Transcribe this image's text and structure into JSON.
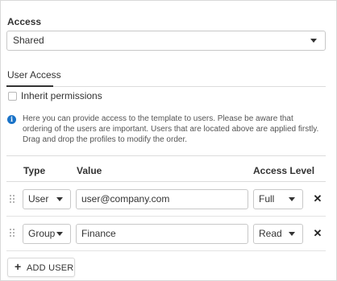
{
  "access": {
    "label": "Access",
    "selected": "Shared"
  },
  "tabs": [
    {
      "label": "User Access",
      "active": true
    }
  ],
  "inherit": {
    "label": "Inherit permissions",
    "checked": false
  },
  "info": {
    "text": "Here you can provide access to the template to users. Please be aware that ordering of the users are important. Users that are located above are applied firstly. Drag and drop the profiles to modify the order."
  },
  "table": {
    "headers": {
      "type": "Type",
      "value": "Value",
      "level": "Access Level"
    },
    "rows": [
      {
        "type": "User",
        "value": "user@company.com",
        "level": "Full"
      },
      {
        "type": "Group",
        "value": "Finance",
        "level": "Read"
      }
    ],
    "remove_glyph": "✕"
  },
  "add_button": {
    "label": "ADD USER",
    "icon": "plus-icon",
    "glyph": "+"
  },
  "icons": {
    "info": "info-icon",
    "dropdown": "chevron-down-icon",
    "drag": "drag-handle-icon",
    "remove": "close-icon"
  },
  "colors": {
    "info": "#1a73c8",
    "text": "#333333",
    "border": "#c8c8c8"
  }
}
